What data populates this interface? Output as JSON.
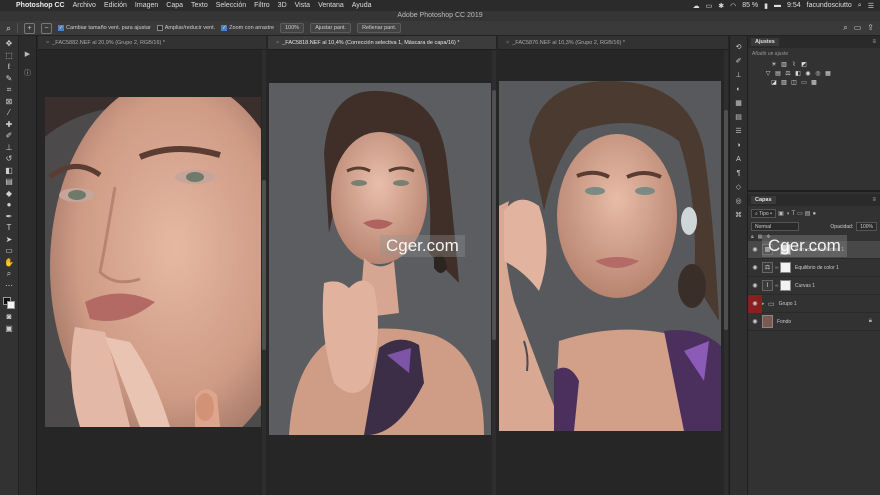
{
  "menubar": {
    "app_name": "Photoshop CC",
    "items": [
      "Archivo",
      "Edición",
      "Imagen",
      "Capa",
      "Texto",
      "Selección",
      "Filtro",
      "3D",
      "Vista",
      "Ventana",
      "Ayuda"
    ],
    "battery": "85 %",
    "time": "9:54",
    "user": "facundosciutto"
  },
  "window": {
    "title": "Adobe Photoshop CC 2019"
  },
  "options": {
    "resize_windows_label": "Cambiar tamaño vent. para ajustar",
    "resize_windows_checked": true,
    "zoom_all_label": "Ampliar/reducir vent.",
    "zoom_all_checked": false,
    "scrubby_zoom_label": "Zoom con arrastre",
    "scrubby_zoom_checked": true,
    "zoom_100_label": "100%",
    "fit_screen_label": "Ajustar pant.",
    "fill_screen_label": "Rellenar pant."
  },
  "documents": [
    {
      "title": "_FAC5882.NEF al 20,9% (Grupo 2, RGB/16) *",
      "active": false,
      "close": "×"
    },
    {
      "title": "_FAC5818.NEF al 10,4% (Corrección selectiva 1, Máscara de capa/16) *",
      "active": true,
      "close": "×"
    },
    {
      "title": "_FAC5876.NEF al 10,3% (Grupo 2, RGB/16) *",
      "active": false,
      "close": "×"
    }
  ],
  "watermarks": [
    "Cger.com",
    "Cger.com"
  ],
  "adjustments_panel": {
    "tab_label": "Ajustes",
    "hint": "Añadir un ajuste",
    "rows": [
      [
        "brightness-icon",
        "levels-icon",
        "curves-icon",
        "exposure-icon"
      ],
      [
        "vibrance-icon",
        "hue-icon",
        "color-balance-icon",
        "bw-icon",
        "photo-filter-icon",
        "channel-mixer-icon",
        "lookup-icon"
      ],
      [
        "invert-icon",
        "posterize-icon",
        "threshold-icon",
        "gradient-map-icon",
        "selective-color-icon"
      ]
    ]
  },
  "layers_panel": {
    "tab_label": "Capas",
    "filter_label": "Tipo",
    "blend_mode": "Normal",
    "opacity_label": "Opacidad:",
    "opacity_value": "100%",
    "layers": [
      {
        "name": "Corrección selectiva 1",
        "type": "adjustment",
        "selected": true,
        "visible": true
      },
      {
        "name": "Equilibrio de color 1",
        "type": "adjustment",
        "selected": false,
        "visible": true
      },
      {
        "name": "Curvas 1",
        "type": "adjustment",
        "selected": false,
        "visible": true
      },
      {
        "name": "Grupo 1",
        "type": "group",
        "selected": false,
        "visible": true
      },
      {
        "name": "Fondo",
        "type": "image",
        "selected": false,
        "visible": true,
        "locked": true
      }
    ]
  },
  "colors": {
    "app_bg": "#262626",
    "panel_bg": "#323232",
    "photo_bg": "#5b5d61",
    "selected_layer": "#484848",
    "visibility_red": "#8a1f1f"
  }
}
